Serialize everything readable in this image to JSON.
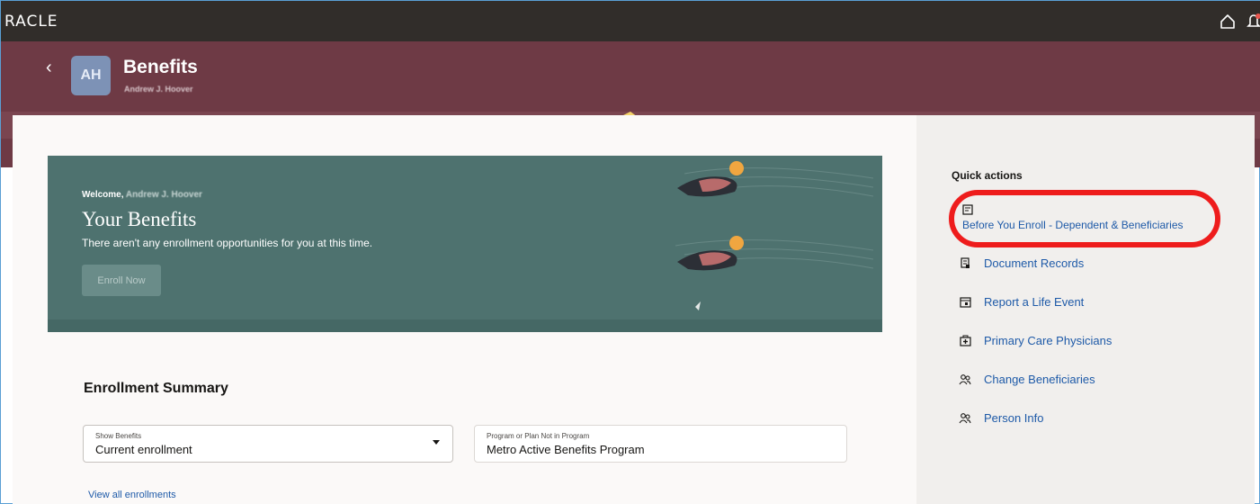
{
  "app": {
    "brand": "RACLE"
  },
  "header": {
    "avatar_initials": "AH",
    "title": "Benefits",
    "subtitle": "Andrew J. Hoover"
  },
  "hero": {
    "welcome_prefix": "Welcome,",
    "welcome_name": "Andrew J. Hoover",
    "title": "Your Benefits",
    "message": "There aren't any enrollment opportunities for you at this time.",
    "enroll_label": "Enroll Now"
  },
  "summary": {
    "title": "Enrollment Summary",
    "show_benefits_label": "Show Benefits",
    "show_benefits_value": "Current enrollment",
    "program_label": "Program or Plan Not in Program",
    "program_value": "Metro Active Benefits Program",
    "view_all_label": "View all enrollments"
  },
  "quick_actions": {
    "title": "Quick actions",
    "items": [
      {
        "label": "Before You Enroll - Dependent & Beneficiaries",
        "icon": "document-icon"
      },
      {
        "label": "Document Records",
        "icon": "document-records-icon"
      },
      {
        "label": "Report a Life Event",
        "icon": "calendar-icon"
      },
      {
        "label": "Primary Care Physicians",
        "icon": "medical-kit-icon"
      },
      {
        "label": "Change Beneficiaries",
        "icon": "people-icon"
      },
      {
        "label": "Person Info",
        "icon": "people-icon"
      }
    ]
  },
  "colors": {
    "topbar": "#312d2a",
    "header_band": "#6e3a45",
    "hero": "#4e726f",
    "link": "#1e5aa8",
    "highlight": "#ee1c1c"
  }
}
